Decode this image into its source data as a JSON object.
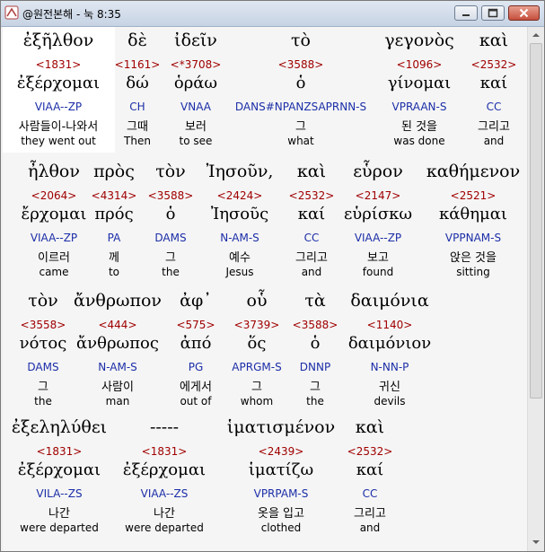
{
  "window": {
    "title": "@원전본해 - 눅 8:35",
    "controls": [
      "minimize-button",
      "maximize-button",
      "close-button"
    ]
  },
  "rows": [
    {
      "words": [
        {
          "greek": "ἐξῆλθον",
          "strong": "<1831>",
          "lexeme": "ἐξέρχομαι",
          "morph": "VIAA--ZP",
          "korean": "사람들이-나와서",
          "english": "they went out"
        },
        {
          "greek": "δὲ",
          "strong": "<1161>",
          "lexeme": "δώ",
          "morph": "CH",
          "korean": "그때",
          "english": "Then"
        },
        {
          "greek": "ἰδεῖν",
          "strong": "<*3708>",
          "lexeme": "ὁράω",
          "morph": "VNAA",
          "korean": "보러",
          "english": "to see"
        },
        {
          "greek": "τὸ",
          "strong": "<3588>",
          "lexeme": "ὁ",
          "morph": "DANS#NPANZSAPRNN-S",
          "korean": "그",
          "english": "what"
        },
        {
          "greek": "γεγονὸς",
          "strong": "<1096>",
          "lexeme": "γίνομαι",
          "morph": "VPRAAN-S",
          "korean": "된 것을",
          "english": "was done"
        },
        {
          "greek": "καὶ",
          "strong": "<2532>",
          "lexeme": "καί",
          "morph": "CC",
          "korean": "그리고",
          "english": "and"
        }
      ]
    },
    {
      "words": [
        {
          "greek": "ἦλθον",
          "strong": "<2064>",
          "lexeme": "ἔρχομαι",
          "morph": "VIAA--ZP",
          "korean": "이르러",
          "english": "came"
        },
        {
          "greek": "πρὸς",
          "strong": "<4314>",
          "lexeme": "πρός",
          "morph": "PA",
          "korean": "께",
          "english": "to"
        },
        {
          "greek": "τὸν",
          "strong": "<3588>",
          "lexeme": "ὁ",
          "morph": "DAMS",
          "korean": "그",
          "english": "the"
        },
        {
          "greek": "Ἰησοῦν,",
          "strong": "<2424>",
          "lexeme": "Ἰησοῦς",
          "morph": "N-AM-S",
          "korean": "예수",
          "english": "Jesus"
        },
        {
          "greek": "καὶ",
          "strong": "<2532>",
          "lexeme": "καί",
          "morph": "CC",
          "korean": "그리고",
          "english": "and"
        },
        {
          "greek": "εὗρον",
          "strong": "<2147>",
          "lexeme": "εὑρίσκω",
          "morph": "VIAA--ZP",
          "korean": "보고",
          "english": "found"
        },
        {
          "greek": "καθήμενον",
          "strong": "<2521>",
          "lexeme": "κάθημαι",
          "morph": "VPPNAM-S",
          "korean": "앉은 것을",
          "english": "sitting"
        }
      ]
    },
    {
      "words": [
        {
          "greek": "τὸν",
          "strong": "<3558>",
          "lexeme": "νότος",
          "morph": "DAMS",
          "korean": "그",
          "english": "the"
        },
        {
          "greek": "ἄνθρωπον",
          "strong": "<444>",
          "lexeme": "ἄνθρωπος",
          "morph": "N-AM-S",
          "korean": "사람이",
          "english": "man"
        },
        {
          "greek": "ἀφ᾽",
          "strong": "<575>",
          "lexeme": "ἀπό",
          "morph": "PG",
          "korean": "에게서",
          "english": "out of"
        },
        {
          "greek": "οὗ",
          "strong": "<3739>",
          "lexeme": "ὅς",
          "morph": "APRGM-S",
          "korean": "그",
          "english": "whom"
        },
        {
          "greek": "τὰ",
          "strong": "<3588>",
          "lexeme": "ὁ",
          "morph": "DNNP",
          "korean": "그",
          "english": "the"
        },
        {
          "greek": "δαιμόνια",
          "strong": "<1140>",
          "lexeme": "δαιμόνιον",
          "morph": "N-NN-P",
          "korean": "귀신",
          "english": "devils"
        }
      ]
    },
    {
      "words": [
        {
          "greek": "ἐξεληλύθει",
          "strong": "<1831>",
          "lexeme": "ἐξέρχομαι",
          "morph": "VILA--ZS",
          "korean": "나간",
          "english": "were departed"
        },
        {
          "greek": "-----",
          "strong": "<1831>",
          "lexeme": "ἐξέρχομαι",
          "morph": "VIAA--ZS",
          "korean": "나간",
          "english": "were departed"
        },
        {
          "greek": "ἱματισμένον",
          "strong": "<2439>",
          "lexeme": "ἱματίζω",
          "morph": "VPRPAM-S",
          "korean": "옷을 입고",
          "english": "clothed"
        },
        {
          "greek": "καὶ",
          "strong": "<2532>",
          "lexeme": "καί",
          "morph": "CC",
          "korean": "그리고",
          "english": "and"
        }
      ]
    }
  ]
}
